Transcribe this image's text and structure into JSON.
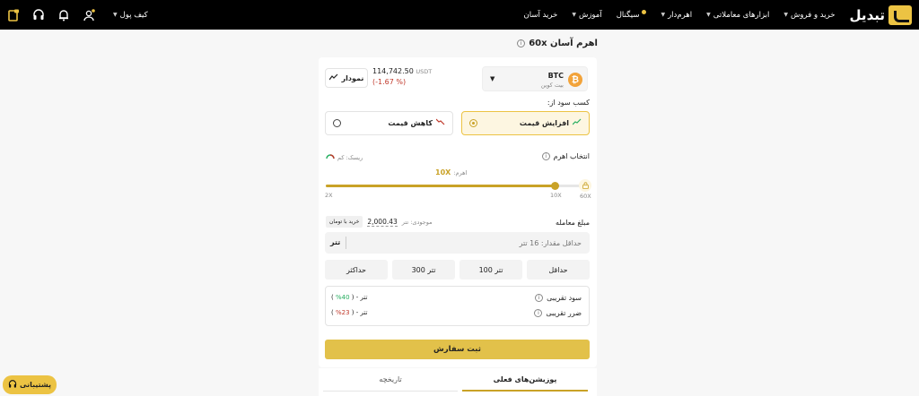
{
  "header": {
    "logo_text": "تبدیل",
    "nav": [
      {
        "label": "خرید و فروش",
        "chevron": true
      },
      {
        "label": "ابزارهای معاملاتی",
        "chevron": true
      },
      {
        "label": "اهرم‌دار",
        "chevron": true
      },
      {
        "label": "سیگنال",
        "chevron": false
      },
      {
        "label": "آموزش",
        "chevron": true
      },
      {
        "label": "خرید آسان",
        "chevron": false
      }
    ],
    "wallet_label": "کیف پول"
  },
  "page": {
    "title": "اهرم آسان 60x"
  },
  "asset": {
    "symbol": "BTC",
    "name": "بیت کوین",
    "price": "114,742.50",
    "price_unit": "USDT",
    "change": "(-1.67 %)",
    "chart_label": "نمودار"
  },
  "profit": {
    "label": "کسب سود از:",
    "increase": "افزایش قیمت",
    "decrease": "کاهش قیمت"
  },
  "leverage": {
    "label": "انتخاب اهرم",
    "risk_label": "ریسک: کم",
    "current_label": "اهرم:",
    "current_value": "10X",
    "min": "2X",
    "selected": "10X",
    "max": "60X",
    "fill_fraction": 0.88
  },
  "amount": {
    "label": "مبلغ معامله",
    "balance_label": "موجودی: تتر",
    "balance_value": "2,000.43",
    "buy_toman": "خرید با تومان",
    "placeholder": "حداقل مقدار: 16 تتر",
    "unit": "تتر",
    "options": [
      "حداقل",
      "100 تتر",
      "300 تتر",
      "حداکثر"
    ]
  },
  "estimate": {
    "profit_label": "سود تقریبی",
    "profit_pct": "40%",
    "profit_value": "تتر -",
    "loss_label": "ضرر تقریبی",
    "loss_pct": "23%",
    "loss_value": "تتر -"
  },
  "submit_label": "ثبت سفارش",
  "tabs": {
    "current": "پوزیشن‌های فعلی",
    "history": "تاریخچه"
  },
  "support_label": "پشتیبانی",
  "colors": {
    "accent": "#ecc343",
    "negative": "#c0392b",
    "positive": "#27ae60"
  }
}
